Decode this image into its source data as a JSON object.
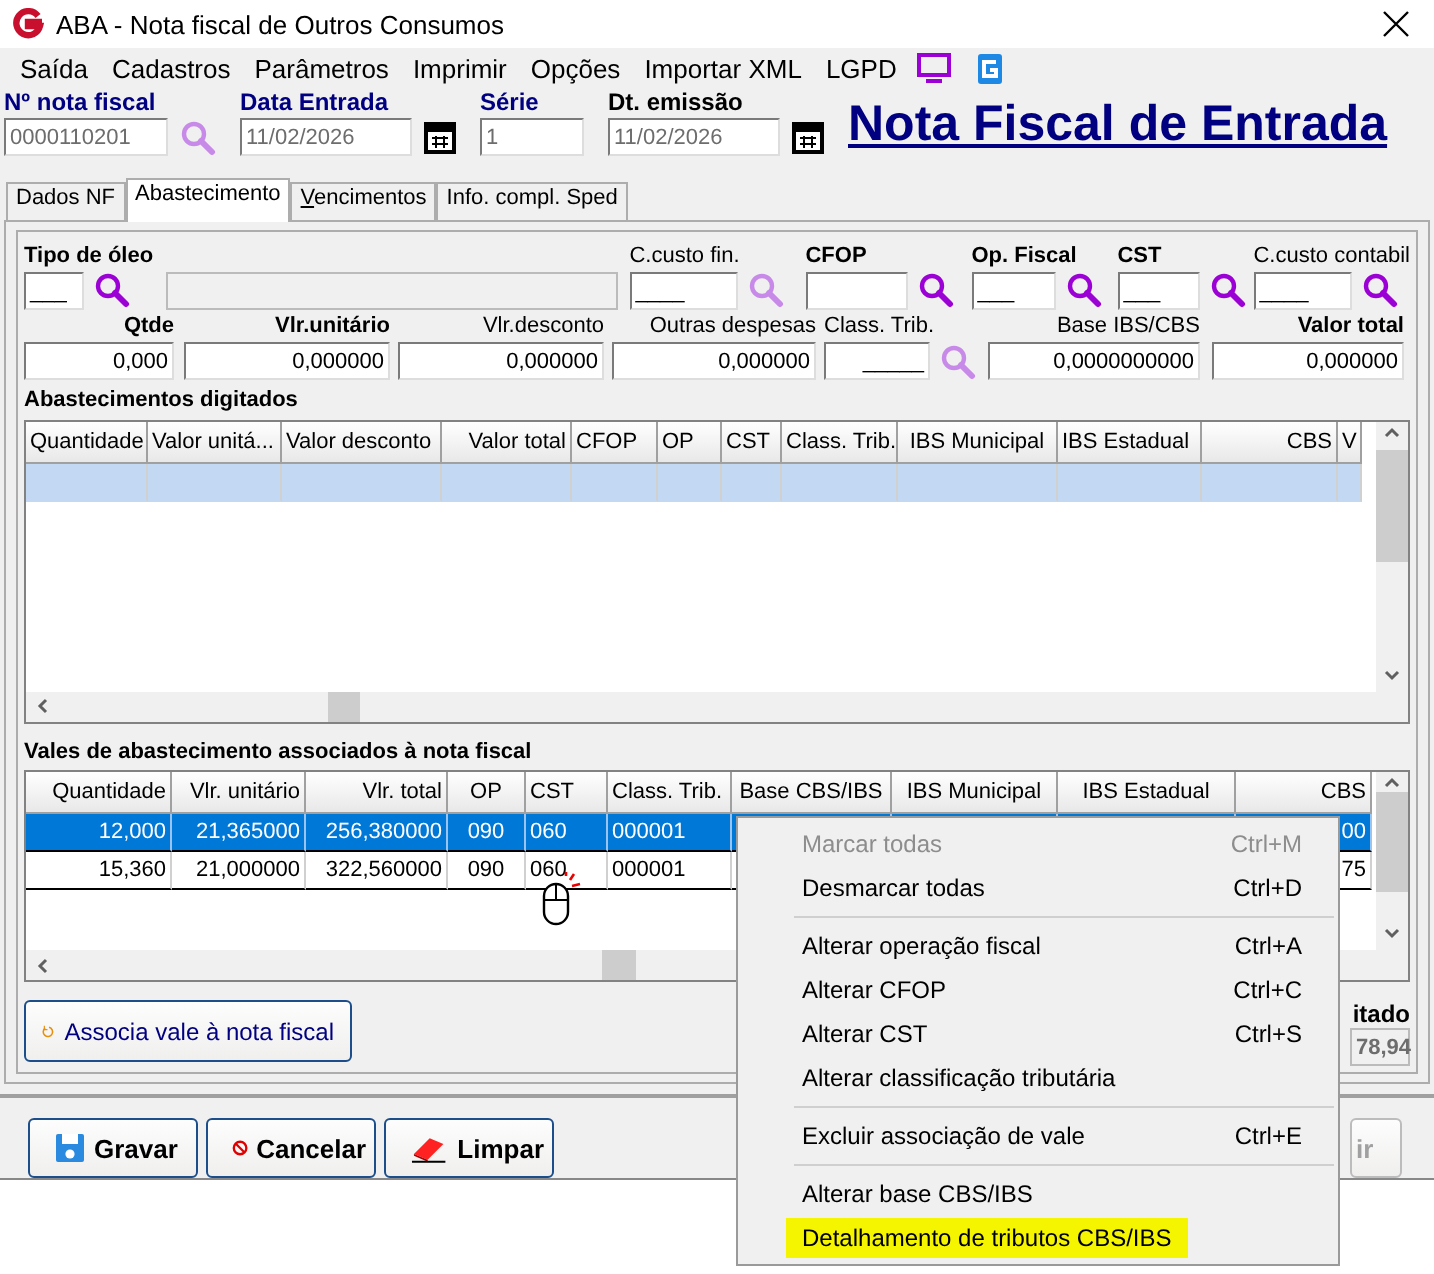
{
  "window": {
    "title": "ABA - Nota fiscal de Outros Consumos"
  },
  "menu": [
    "Saída",
    "Cadastros",
    "Parâmetros",
    "Imprimir",
    "Opções",
    "Importar XML",
    "LGPD"
  ],
  "header_fields": [
    {
      "label": "Nº nota fiscal",
      "value": "0000110201",
      "color": "#000080"
    },
    {
      "label": "Data Entrada",
      "value": "11/02/2026",
      "color": "#000080"
    },
    {
      "label": "Série",
      "value": "1",
      "color": "#000080"
    },
    {
      "label": "Dt. emissão",
      "value": "11/02/2026",
      "color": "#000000"
    }
  ],
  "page_title": "Nota Fiscal de Entrada",
  "tabs": [
    {
      "label": "Dados NF",
      "selected": false,
      "access_key": false
    },
    {
      "label": "Abastecimento",
      "selected": true,
      "access_key": false
    },
    {
      "label": "Vencimentos",
      "selected": false,
      "access_key": true
    },
    {
      "label": "Info. compl. Sped",
      "selected": false,
      "access_key": false
    }
  ],
  "fuel_fields": [
    {
      "label": "Tipo de óleo",
      "bold": true,
      "value": "___"
    },
    {
      "disabled": true
    },
    {
      "label": "C.custo fin.",
      "bold": false,
      "value": "____"
    },
    {
      "label": "CFOP",
      "bold": true
    },
    {
      "label": "Op. Fiscal",
      "bold": true,
      "value": "___"
    },
    {
      "label": "CST",
      "bold": true,
      "value": "___"
    },
    {
      "label": "C.custo contabil",
      "bold": false,
      "value": "____"
    }
  ],
  "value_fields": [
    {
      "label": "Qtde",
      "bold": true,
      "value": "0,000"
    },
    {
      "label": "Vlr.unitário",
      "bold": true,
      "value": "0,000000"
    },
    {
      "label": "Vlr.desconto",
      "bold": false,
      "value": "0,000000"
    },
    {
      "label": "Outras despesas",
      "bold": false,
      "value": "0,000000"
    },
    {
      "label": "Class. Trib.",
      "bold": false,
      "value": "_____"
    },
    {
      "label": "Base IBS/CBS",
      "bold": false,
      "value": "0,0000000000"
    },
    {
      "label": "Valor total",
      "bold": true,
      "value": "0,000000"
    }
  ],
  "typed_table": {
    "title": "Abastecimentos digitados",
    "columns": [
      "Quantidade",
      "Valor unitá...",
      "Valor desconto",
      "Valor total",
      "CFOP",
      "OP",
      "CST",
      "Class. Trib.",
      "IBS Municipal",
      "IBS Estadual",
      "CBS",
      "V"
    ],
    "rows": [
      {
        "selected": true
      }
    ]
  },
  "linked_table": {
    "title": "Vales de abastecimento associados à nota fiscal",
    "columns": [
      "Quantidade",
      "Vlr. unitário",
      "Vlr. total",
      "OP",
      "CST",
      "Class. Trib.",
      "Base CBS/IBS",
      "IBS Municipal",
      "IBS Estadual",
      "CBS"
    ],
    "rows": [
      {
        "selected": true,
        "cells": [
          "12,000",
          "21,365000",
          "256,380000",
          "090",
          "060",
          "000001"
        ],
        "last_cell": "00"
      },
      {
        "selected": false,
        "cells": [
          "15,360",
          "21,000000",
          "322,560000",
          "090",
          "060",
          "000001"
        ],
        "last_cell": "75"
      }
    ]
  },
  "associate_button": "Associa vale à nota fiscal",
  "total": {
    "label": "itado",
    "value": "78,94"
  },
  "footer_buttons": [
    {
      "label": "Gravar",
      "disabled": false
    },
    {
      "label": "Cancelar",
      "disabled": false
    },
    {
      "label": "Limpar",
      "disabled": false
    },
    {
      "label": "ir",
      "disabled": true
    }
  ],
  "context_menu": [
    {
      "kind": "item",
      "label": "Marcar todas",
      "shortcut": "Ctrl+M",
      "disabled": true,
      "highlighted": false
    },
    {
      "kind": "item",
      "label": "Desmarcar todas",
      "shortcut": "Ctrl+D",
      "disabled": false,
      "highlighted": false
    },
    {
      "kind": "separator"
    },
    {
      "kind": "item",
      "label": "Alterar operação fiscal",
      "shortcut": "Ctrl+A",
      "disabled": false,
      "highlighted": false
    },
    {
      "kind": "item",
      "label": "Alterar CFOP",
      "shortcut": "Ctrl+C",
      "disabled": false,
      "highlighted": false
    },
    {
      "kind": "item",
      "label": "Alterar CST",
      "shortcut": "Ctrl+S",
      "disabled": false,
      "highlighted": false
    },
    {
      "kind": "item",
      "label": "Alterar classificação tributária",
      "disabled": false,
      "highlighted": false
    },
    {
      "kind": "separator"
    },
    {
      "kind": "item",
      "label": "Excluir associação de vale",
      "shortcut": "Ctrl+E",
      "disabled": false,
      "highlighted": false
    },
    {
      "kind": "separator"
    },
    {
      "kind": "item",
      "label": "Alterar base CBS/IBS",
      "disabled": false,
      "highlighted": false
    },
    {
      "kind": "item",
      "label": "Detalhamento de tributos CBS/IBS",
      "disabled": false,
      "highlighted": true
    }
  ]
}
